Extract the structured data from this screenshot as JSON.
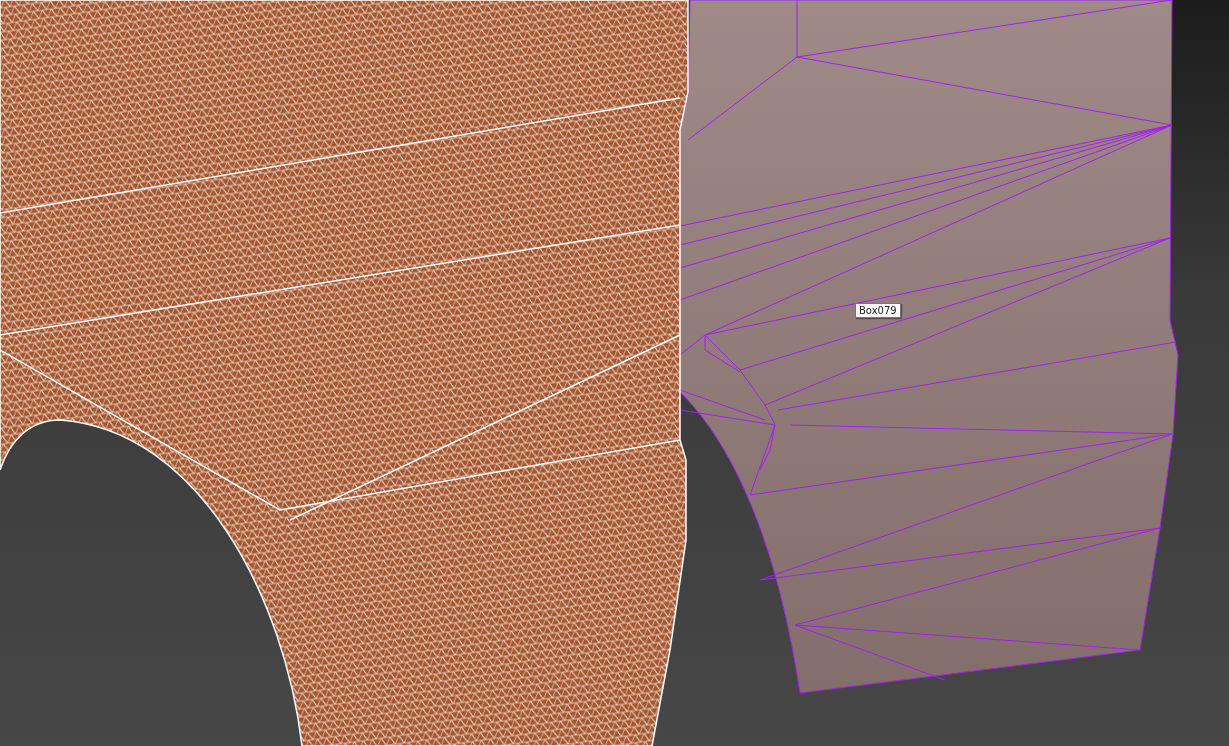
{
  "viewport": {
    "object_label": "Box079"
  }
}
